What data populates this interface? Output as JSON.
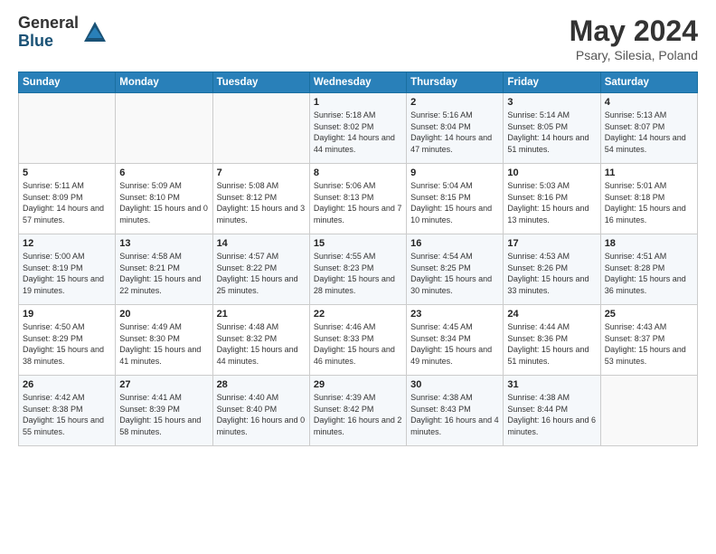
{
  "header": {
    "logo_general": "General",
    "logo_blue": "Blue",
    "title": "May 2024",
    "subtitle": "Psary, Silesia, Poland"
  },
  "weekdays": [
    "Sunday",
    "Monday",
    "Tuesday",
    "Wednesday",
    "Thursday",
    "Friday",
    "Saturday"
  ],
  "weeks": [
    [
      {
        "day": "",
        "sunrise": "",
        "sunset": "",
        "daylight": ""
      },
      {
        "day": "",
        "sunrise": "",
        "sunset": "",
        "daylight": ""
      },
      {
        "day": "",
        "sunrise": "",
        "sunset": "",
        "daylight": ""
      },
      {
        "day": "1",
        "sunrise": "Sunrise: 5:18 AM",
        "sunset": "Sunset: 8:02 PM",
        "daylight": "Daylight: 14 hours and 44 minutes."
      },
      {
        "day": "2",
        "sunrise": "Sunrise: 5:16 AM",
        "sunset": "Sunset: 8:04 PM",
        "daylight": "Daylight: 14 hours and 47 minutes."
      },
      {
        "day": "3",
        "sunrise": "Sunrise: 5:14 AM",
        "sunset": "Sunset: 8:05 PM",
        "daylight": "Daylight: 14 hours and 51 minutes."
      },
      {
        "day": "4",
        "sunrise": "Sunrise: 5:13 AM",
        "sunset": "Sunset: 8:07 PM",
        "daylight": "Daylight: 14 hours and 54 minutes."
      }
    ],
    [
      {
        "day": "5",
        "sunrise": "Sunrise: 5:11 AM",
        "sunset": "Sunset: 8:09 PM",
        "daylight": "Daylight: 14 hours and 57 minutes."
      },
      {
        "day": "6",
        "sunrise": "Sunrise: 5:09 AM",
        "sunset": "Sunset: 8:10 PM",
        "daylight": "Daylight: 15 hours and 0 minutes."
      },
      {
        "day": "7",
        "sunrise": "Sunrise: 5:08 AM",
        "sunset": "Sunset: 8:12 PM",
        "daylight": "Daylight: 15 hours and 3 minutes."
      },
      {
        "day": "8",
        "sunrise": "Sunrise: 5:06 AM",
        "sunset": "Sunset: 8:13 PM",
        "daylight": "Daylight: 15 hours and 7 minutes."
      },
      {
        "day": "9",
        "sunrise": "Sunrise: 5:04 AM",
        "sunset": "Sunset: 8:15 PM",
        "daylight": "Daylight: 15 hours and 10 minutes."
      },
      {
        "day": "10",
        "sunrise": "Sunrise: 5:03 AM",
        "sunset": "Sunset: 8:16 PM",
        "daylight": "Daylight: 15 hours and 13 minutes."
      },
      {
        "day": "11",
        "sunrise": "Sunrise: 5:01 AM",
        "sunset": "Sunset: 8:18 PM",
        "daylight": "Daylight: 15 hours and 16 minutes."
      }
    ],
    [
      {
        "day": "12",
        "sunrise": "Sunrise: 5:00 AM",
        "sunset": "Sunset: 8:19 PM",
        "daylight": "Daylight: 15 hours and 19 minutes."
      },
      {
        "day": "13",
        "sunrise": "Sunrise: 4:58 AM",
        "sunset": "Sunset: 8:21 PM",
        "daylight": "Daylight: 15 hours and 22 minutes."
      },
      {
        "day": "14",
        "sunrise": "Sunrise: 4:57 AM",
        "sunset": "Sunset: 8:22 PM",
        "daylight": "Daylight: 15 hours and 25 minutes."
      },
      {
        "day": "15",
        "sunrise": "Sunrise: 4:55 AM",
        "sunset": "Sunset: 8:23 PM",
        "daylight": "Daylight: 15 hours and 28 minutes."
      },
      {
        "day": "16",
        "sunrise": "Sunrise: 4:54 AM",
        "sunset": "Sunset: 8:25 PM",
        "daylight": "Daylight: 15 hours and 30 minutes."
      },
      {
        "day": "17",
        "sunrise": "Sunrise: 4:53 AM",
        "sunset": "Sunset: 8:26 PM",
        "daylight": "Daylight: 15 hours and 33 minutes."
      },
      {
        "day": "18",
        "sunrise": "Sunrise: 4:51 AM",
        "sunset": "Sunset: 8:28 PM",
        "daylight": "Daylight: 15 hours and 36 minutes."
      }
    ],
    [
      {
        "day": "19",
        "sunrise": "Sunrise: 4:50 AM",
        "sunset": "Sunset: 8:29 PM",
        "daylight": "Daylight: 15 hours and 38 minutes."
      },
      {
        "day": "20",
        "sunrise": "Sunrise: 4:49 AM",
        "sunset": "Sunset: 8:30 PM",
        "daylight": "Daylight: 15 hours and 41 minutes."
      },
      {
        "day": "21",
        "sunrise": "Sunrise: 4:48 AM",
        "sunset": "Sunset: 8:32 PM",
        "daylight": "Daylight: 15 hours and 44 minutes."
      },
      {
        "day": "22",
        "sunrise": "Sunrise: 4:46 AM",
        "sunset": "Sunset: 8:33 PM",
        "daylight": "Daylight: 15 hours and 46 minutes."
      },
      {
        "day": "23",
        "sunrise": "Sunrise: 4:45 AM",
        "sunset": "Sunset: 8:34 PM",
        "daylight": "Daylight: 15 hours and 49 minutes."
      },
      {
        "day": "24",
        "sunrise": "Sunrise: 4:44 AM",
        "sunset": "Sunset: 8:36 PM",
        "daylight": "Daylight: 15 hours and 51 minutes."
      },
      {
        "day": "25",
        "sunrise": "Sunrise: 4:43 AM",
        "sunset": "Sunset: 8:37 PM",
        "daylight": "Daylight: 15 hours and 53 minutes."
      }
    ],
    [
      {
        "day": "26",
        "sunrise": "Sunrise: 4:42 AM",
        "sunset": "Sunset: 8:38 PM",
        "daylight": "Daylight: 15 hours and 55 minutes."
      },
      {
        "day": "27",
        "sunrise": "Sunrise: 4:41 AM",
        "sunset": "Sunset: 8:39 PM",
        "daylight": "Daylight: 15 hours and 58 minutes."
      },
      {
        "day": "28",
        "sunrise": "Sunrise: 4:40 AM",
        "sunset": "Sunset: 8:40 PM",
        "daylight": "Daylight: 16 hours and 0 minutes."
      },
      {
        "day": "29",
        "sunrise": "Sunrise: 4:39 AM",
        "sunset": "Sunset: 8:42 PM",
        "daylight": "Daylight: 16 hours and 2 minutes."
      },
      {
        "day": "30",
        "sunrise": "Sunrise: 4:38 AM",
        "sunset": "Sunset: 8:43 PM",
        "daylight": "Daylight: 16 hours and 4 minutes."
      },
      {
        "day": "31",
        "sunrise": "Sunrise: 4:38 AM",
        "sunset": "Sunset: 8:44 PM",
        "daylight": "Daylight: 16 hours and 6 minutes."
      },
      {
        "day": "",
        "sunrise": "",
        "sunset": "",
        "daylight": ""
      }
    ]
  ]
}
